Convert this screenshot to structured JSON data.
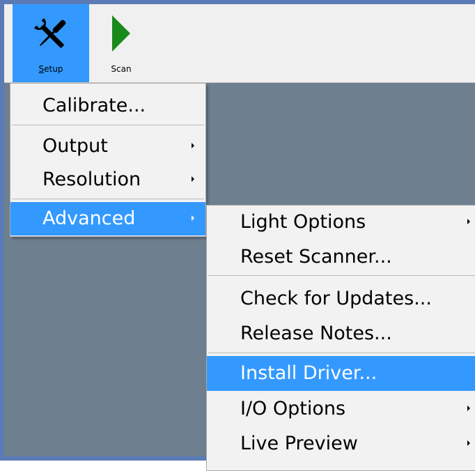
{
  "toolbar": {
    "setup": {
      "label_accel": "S",
      "label_rest": "etup",
      "icon": "tools-icon"
    },
    "scan": {
      "label": "Scan",
      "icon": "play-icon"
    }
  },
  "colors": {
    "accent": "#3399ff",
    "workspace": "#6e7f8f",
    "menu_bg": "#f2f2f2",
    "play_green": "#1a8a1a",
    "frame_border": "#5a7bb5"
  },
  "setup_menu": {
    "items": [
      {
        "label": "Calibrate..."
      },
      {
        "label": "Output",
        "submenu": true
      },
      {
        "label": "Resolution",
        "submenu": true
      },
      {
        "label": "Advanced",
        "submenu": true,
        "highlighted": true
      }
    ]
  },
  "advanced_menu": {
    "items": [
      {
        "label": "Light Options",
        "submenu": true
      },
      {
        "label": "Reset Scanner..."
      },
      {
        "label": "Check for Updates..."
      },
      {
        "label": "Release Notes..."
      },
      {
        "label": "Install Driver...",
        "highlighted": true
      },
      {
        "label": "I/O Options",
        "submenu": true
      },
      {
        "label": "Live Preview",
        "submenu": true
      }
    ]
  }
}
